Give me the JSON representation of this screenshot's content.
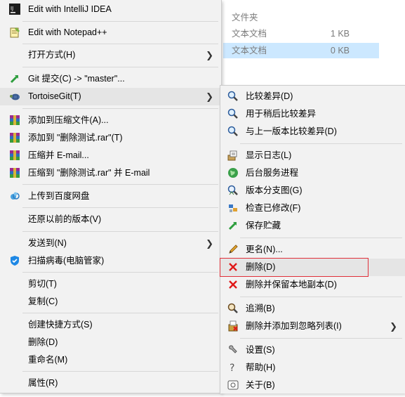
{
  "explorer": {
    "header": "文件夹",
    "rows": [
      {
        "name": "文本文档",
        "size": "1 KB"
      },
      {
        "name": "文本文档",
        "size": "0 KB"
      }
    ]
  },
  "menu1": {
    "items": [
      {
        "label": "Edit with IntelliJ IDEA",
        "icon": "intellij-icon"
      },
      {
        "label": "Edit with Notepad++",
        "icon": "notepad-plus-plus-icon"
      },
      {
        "label": "打开方式(H)",
        "icon": "",
        "arrow": "❯"
      },
      {
        "label": "Git 提交(C) -> \"master\"...",
        "icon": "git-commit-icon"
      },
      {
        "label": "TortoiseGit(T)",
        "icon": "tortoisegit-icon",
        "arrow": "❯"
      },
      {
        "label": "添加到压缩文件(A)...",
        "icon": "winrar-icon"
      },
      {
        "label": "添加到 \"删除测试.rar\"(T)",
        "icon": "winrar-icon"
      },
      {
        "label": "压缩并 E-mail...",
        "icon": "winrar-icon"
      },
      {
        "label": "压缩到 \"删除测试.rar\" 并 E-mail",
        "icon": "winrar-icon"
      },
      {
        "label": "上传到百度网盘",
        "icon": "baidu-netdisk-icon"
      },
      {
        "label": "还原以前的版本(V)",
        "icon": ""
      },
      {
        "label": "发送到(N)",
        "icon": "",
        "arrow": "❯"
      },
      {
        "label": "扫描病毒(电脑管家)",
        "icon": "shield-icon"
      },
      {
        "label": "剪切(T)",
        "icon": ""
      },
      {
        "label": "复制(C)",
        "icon": ""
      },
      {
        "label": "创建快捷方式(S)",
        "icon": ""
      },
      {
        "label": "删除(D)",
        "icon": ""
      },
      {
        "label": "重命名(M)",
        "icon": ""
      },
      {
        "label": "属性(R)",
        "icon": ""
      }
    ]
  },
  "menu2": {
    "items": [
      {
        "label": "比较差异(D)",
        "icon": "magnifier-icon"
      },
      {
        "label": "用于稍后比较差异",
        "icon": "magnifier-icon"
      },
      {
        "label": "与上一版本比较差异(D)",
        "icon": "magnifier-icon"
      },
      {
        "label": "显示日志(L)",
        "icon": "log-icon"
      },
      {
        "label": "后台服务进程",
        "icon": "globe-icon"
      },
      {
        "label": "版本分支图(G)",
        "icon": "revision-graph-icon"
      },
      {
        "label": "检查已修改(F)",
        "icon": "check-modified-icon"
      },
      {
        "label": "保存贮藏",
        "icon": "stash-icon"
      },
      {
        "label": "更名(N)...",
        "icon": "pencil-icon"
      },
      {
        "label": "删除(D)",
        "icon": "red-x-icon"
      },
      {
        "label": "删除并保留本地副本(D)",
        "icon": "red-x-icon"
      },
      {
        "label": "追溯(B)",
        "icon": "blame-icon"
      },
      {
        "label": "删除并添加到忽略列表(I)",
        "icon": "ignore-icon",
        "arrow": "❯"
      },
      {
        "label": "设置(S)",
        "icon": "settings-icon"
      },
      {
        "label": "帮助(H)",
        "icon": "help-icon"
      },
      {
        "label": "关于(B)",
        "icon": "about-icon"
      }
    ]
  },
  "colors": {
    "highlight": "#e5e5e5",
    "selection": "#cce8ff",
    "red_box": "#e0303a"
  }
}
